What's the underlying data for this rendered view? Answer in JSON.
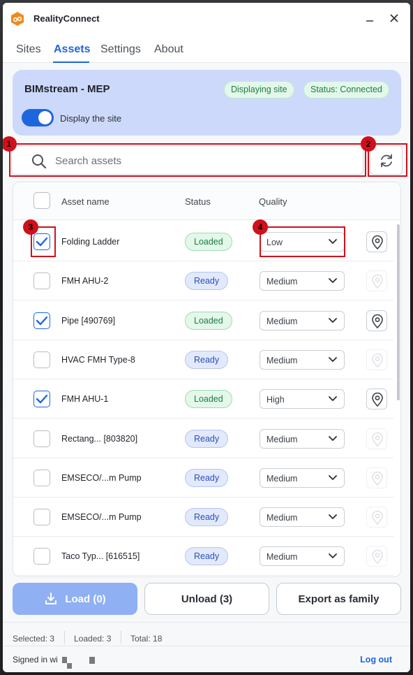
{
  "window": {
    "title": "RealityConnect"
  },
  "tabs": [
    {
      "label": "Sites"
    },
    {
      "label": "Assets"
    },
    {
      "label": "Settings"
    },
    {
      "label": "About"
    }
  ],
  "site": {
    "name": "BIMstream - MEP",
    "display_badge": "Displaying site",
    "status_badge": "Status: Connected",
    "toggle_label": "Display the site",
    "toggle_on": true
  },
  "search": {
    "placeholder": "Search assets"
  },
  "table": {
    "headers": {
      "name": "Asset name",
      "status": "Status",
      "quality": "Quality"
    },
    "rows": [
      {
        "checked": true,
        "name": "Folding Ladder",
        "status": "Loaded",
        "quality": "Low",
        "located": true
      },
      {
        "checked": false,
        "name": "FMH AHU-2",
        "status": "Ready",
        "quality": "Medium",
        "located": false
      },
      {
        "checked": true,
        "name": "Pipe [490769]",
        "status": "Loaded",
        "quality": "Medium",
        "located": true
      },
      {
        "checked": false,
        "name": "HVAC FMH Type-8",
        "status": "Ready",
        "quality": "Medium",
        "located": false
      },
      {
        "checked": true,
        "name": "FMH AHU-1",
        "status": "Loaded",
        "quality": "High",
        "located": true
      },
      {
        "checked": false,
        "name": "Rectang... [803820]",
        "status": "Ready",
        "quality": "Medium",
        "located": false
      },
      {
        "checked": false,
        "name": "EMSECO/...m Pump",
        "status": "Ready",
        "quality": "Medium",
        "located": false
      },
      {
        "checked": false,
        "name": "EMSECO/...m Pump",
        "status": "Ready",
        "quality": "Medium",
        "located": false
      },
      {
        "checked": false,
        "name": "Taco Typ... [616515]",
        "status": "Ready",
        "quality": "Medium",
        "located": false
      }
    ]
  },
  "actions": {
    "load": "Load (0)",
    "unload": "Unload (3)",
    "export": "Export as family"
  },
  "stats": {
    "selected": "Selected: 3",
    "loaded": "Loaded: 3",
    "total": "Total: 18"
  },
  "footer": {
    "signed_in": "Signed in wi",
    "logout": "Log out"
  },
  "annotations": [
    "1",
    "2",
    "3",
    "4"
  ],
  "colors": {
    "accent": "#1e66e0",
    "annotation": "#d0101a",
    "loaded": "#1b7d43",
    "ready": "#2a50b8"
  }
}
